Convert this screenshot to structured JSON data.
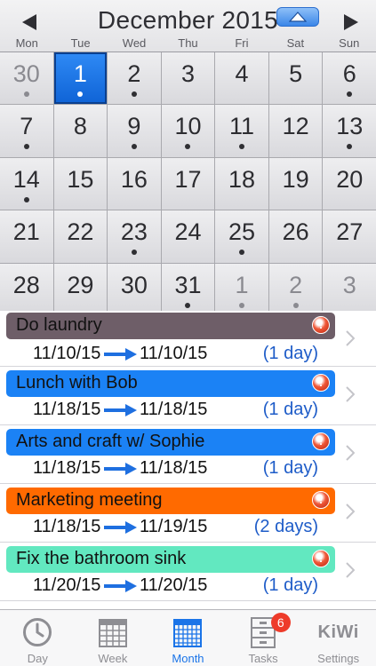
{
  "header": {
    "month_title": "December 2015",
    "days_of_week": [
      "Mon",
      "Tue",
      "Wed",
      "Thu",
      "Fri",
      "Sat",
      "Sun"
    ]
  },
  "calendar": {
    "weeks": [
      [
        {
          "day": "30",
          "other": true,
          "dot": true
        },
        {
          "day": "1",
          "selected": true,
          "dot": true
        },
        {
          "day": "2",
          "dot": true
        },
        {
          "day": "3"
        },
        {
          "day": "4"
        },
        {
          "day": "5"
        },
        {
          "day": "6",
          "dot": true
        }
      ],
      [
        {
          "day": "7",
          "dot": true
        },
        {
          "day": "8"
        },
        {
          "day": "9",
          "dot": true
        },
        {
          "day": "10",
          "dot": true
        },
        {
          "day": "11",
          "dot": true
        },
        {
          "day": "12"
        },
        {
          "day": "13",
          "dot": true
        }
      ],
      [
        {
          "day": "14",
          "dot": true
        },
        {
          "day": "15"
        },
        {
          "day": "16"
        },
        {
          "day": "17"
        },
        {
          "day": "18"
        },
        {
          "day": "19"
        },
        {
          "day": "20"
        }
      ],
      [
        {
          "day": "21"
        },
        {
          "day": "22"
        },
        {
          "day": "23",
          "dot": true
        },
        {
          "day": "24"
        },
        {
          "day": "25",
          "dot": true
        },
        {
          "day": "26"
        },
        {
          "day": "27"
        }
      ],
      [
        {
          "day": "28"
        },
        {
          "day": "29"
        },
        {
          "day": "30"
        },
        {
          "day": "31",
          "dot": true
        },
        {
          "day": "1",
          "other": true,
          "dot": true
        },
        {
          "day": "2",
          "other": true,
          "dot": true
        },
        {
          "day": "3",
          "other": true
        }
      ]
    ]
  },
  "events": [
    {
      "title": "Do laundry",
      "start": "11/10/15",
      "end": "11/10/15",
      "duration": "(1 day)",
      "color": "#6e5e68"
    },
    {
      "title": "Lunch with Bob",
      "start": "11/18/15",
      "end": "11/18/15",
      "duration": "(1 day)",
      "color": "#1b82f5"
    },
    {
      "title": "Arts and craft w/ Sophie",
      "start": "11/18/15",
      "end": "11/18/15",
      "duration": "(1 day)",
      "color": "#1b82f5"
    },
    {
      "title": "Marketing meeting",
      "start": "11/18/15",
      "end": "11/19/15",
      "duration": "(2 days)",
      "color": "#ff6a00"
    },
    {
      "title": "Fix the bathroom sink",
      "start": "11/20/15",
      "end": "11/20/15",
      "duration": "(1 day)",
      "color": "#62e8c0"
    }
  ],
  "tabbar": {
    "tabs": [
      {
        "label": "Day",
        "icon": "clock-icon"
      },
      {
        "label": "Week",
        "icon": "week-calendar-icon"
      },
      {
        "label": "Month",
        "icon": "month-calendar-icon",
        "active": true
      },
      {
        "label": "Tasks",
        "icon": "tasks-cabinet-icon",
        "badge": "6"
      },
      {
        "label": "Settings",
        "icon": "kiwi-logo",
        "logo_text": "KiWi"
      }
    ]
  },
  "colors": {
    "accent": "#1a74e8",
    "selected_day": "#1b6fe0",
    "badge": "#ee3b2a",
    "alert": "#e0452a",
    "duration_text": "#1e5cc8"
  }
}
